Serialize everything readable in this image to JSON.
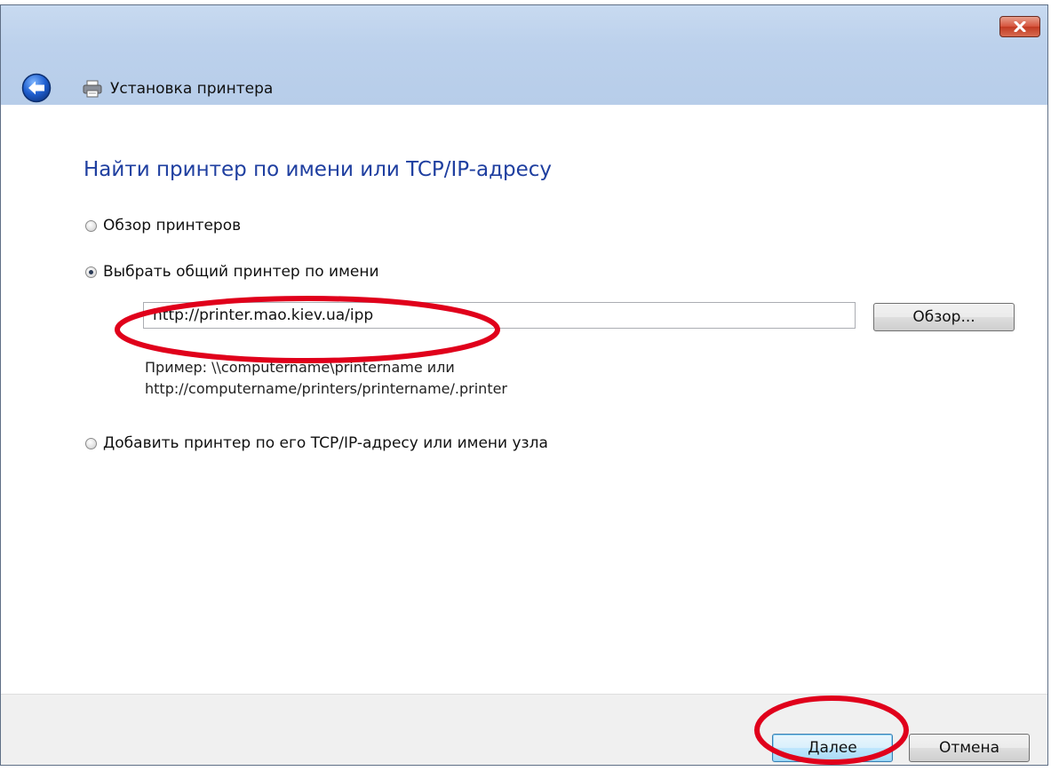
{
  "window": {
    "title": "Установка принтера"
  },
  "page": {
    "heading": "Найти принтер по имени или TCP/IP-адресу"
  },
  "options": [
    {
      "label": "Обзор принтеров",
      "checked": false
    },
    {
      "label": "Выбрать общий принтер по имени",
      "checked": true
    },
    {
      "label": "Добавить принтер по его TCP/IP-адресу или имени узла",
      "checked": false
    }
  ],
  "printer_name_field": {
    "value": "http://printer.mao.kiev.ua/ipp"
  },
  "browse_button": {
    "label": "Обзор..."
  },
  "hint": {
    "line1": "Пример: \\\\computername\\printername или",
    "line2": "http://computername/printers/printername/.printer"
  },
  "footer": {
    "next_label": "Далее",
    "cancel_label": "Отмена"
  },
  "annotation_color": "#e0001b",
  "icons": [
    "close-icon",
    "back-arrow-icon",
    "printer-icon"
  ]
}
